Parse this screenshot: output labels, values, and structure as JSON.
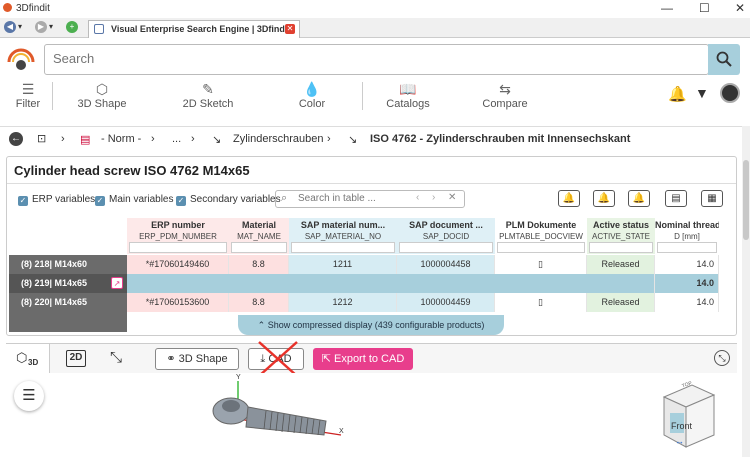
{
  "window": {
    "app_name": "3Dfindit",
    "min": "—",
    "max": "☐",
    "close": "✕"
  },
  "browser": {
    "tab_title": "Visual Enterprise Search Engine | 3Dfindit",
    "tab_close": "✕"
  },
  "search": {
    "placeholder": "Search"
  },
  "toolbar": {
    "filter": "Filter",
    "shape3d": "3D Shape",
    "sketch2d": "2D Sketch",
    "color": "Color",
    "catalogs": "Catalogs",
    "compare": "Compare"
  },
  "breadcrumb": {
    "norm": "- Norm -",
    "ellipsis": "...",
    "zylinder": "Zylinderschrauben",
    "iso": "ISO 4762 - Zylinderschrauben mit Innensechskant"
  },
  "panel": {
    "title": "Cylinder head screw ISO 4762 M14x65",
    "erp_variables": "ERP variables",
    "main_variables": "Main variables",
    "secondary_variables": "Secondary variables",
    "search_in_table": "Search in table ..."
  },
  "table": {
    "columns": [
      {
        "title": "ERP number",
        "sub": "ERP_PDM_NUMBER"
      },
      {
        "title": "Material",
        "sub": "MAT_NAME"
      },
      {
        "title": "SAP material num...",
        "sub": "SAP_MATERIAL_NO"
      },
      {
        "title": "SAP document ...",
        "sub": "SAP_DOCID"
      },
      {
        "title": "PLM Dokumente",
        "sub": "PLMTABLE_DOCVIEW"
      },
      {
        "title": "Active status",
        "sub": "ACTIVE_STATE"
      },
      {
        "title": "Nominal thread",
        "sub": "D [mm]"
      }
    ],
    "rows": [
      {
        "label": "(8) 218| M14x60",
        "cells": [
          "*#17060149460",
          "8.8",
          "1211",
          "1000004458",
          "",
          "Released",
          "14.0"
        ]
      },
      {
        "label": "(8) 219| M14x65",
        "cells": [
          "",
          "",
          "",
          "",
          "",
          "",
          "14.0"
        ]
      },
      {
        "label": "(8) 220| M14x65",
        "cells": [
          "*#17060153600",
          "8.8",
          "1212",
          "1000004459",
          "",
          "Released",
          "14.0"
        ]
      }
    ],
    "compress": "Show compressed display (439 configurable products)"
  },
  "bottom": {
    "tab_3d": "3D",
    "tab_2d": "2D",
    "shape3d_btn": "3D Shape",
    "cad_btn": "CAD",
    "export_btn": "Export to CAD"
  },
  "viewer": {
    "axis_y": "Y",
    "axis_x": "X",
    "cube_front": "Front",
    "cube_top": "TOP"
  },
  "colors": {
    "accent": "#a7cfdc",
    "export": "#e83e8c",
    "erp_cell": "#fde0e0",
    "sap_cell": "#d6ecf3",
    "status_cell": "#e2f2df",
    "row_label": "#6b6b6b"
  }
}
